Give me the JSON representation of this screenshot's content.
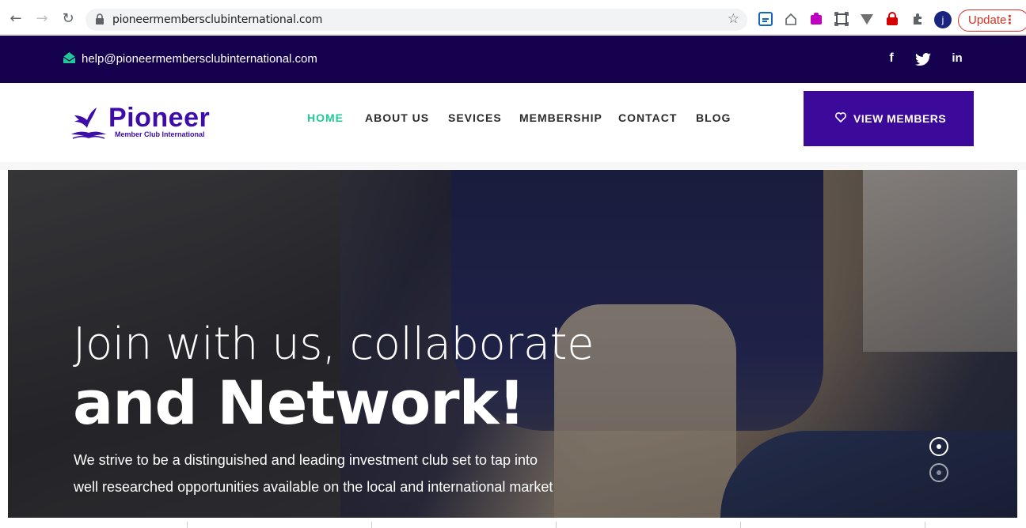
{
  "browser": {
    "url": "pioneermembersclubinternational.com",
    "update_label": "Update",
    "profile_initial": "j",
    "menu_dots": "⋮"
  },
  "topbar": {
    "email": "help@pioneermembersclubinternational.com",
    "social": [
      "f",
      "t",
      "in"
    ]
  },
  "logo": {
    "title": "Pioneer",
    "subtitle": "Member Club International"
  },
  "nav": {
    "items": [
      "HOME",
      "ABOUT US",
      "SEVICES",
      "MEMBERSHIP",
      "CONTACT",
      "BLOG"
    ],
    "active_index": 0
  },
  "cta": {
    "label": "VIEW MEMBERS"
  },
  "hero": {
    "line1": "Join with us, collaborate",
    "line2": "and Network!",
    "description": "We strive to be a distinguished and leading investment club set to tap into well researched opportunities available on the local and international market",
    "slides": 2,
    "active_slide": 0
  },
  "colors": {
    "brand": "#3b0a9b",
    "topbar": "#16014f",
    "accent": "#20c997",
    "update_red": "#d93025"
  }
}
